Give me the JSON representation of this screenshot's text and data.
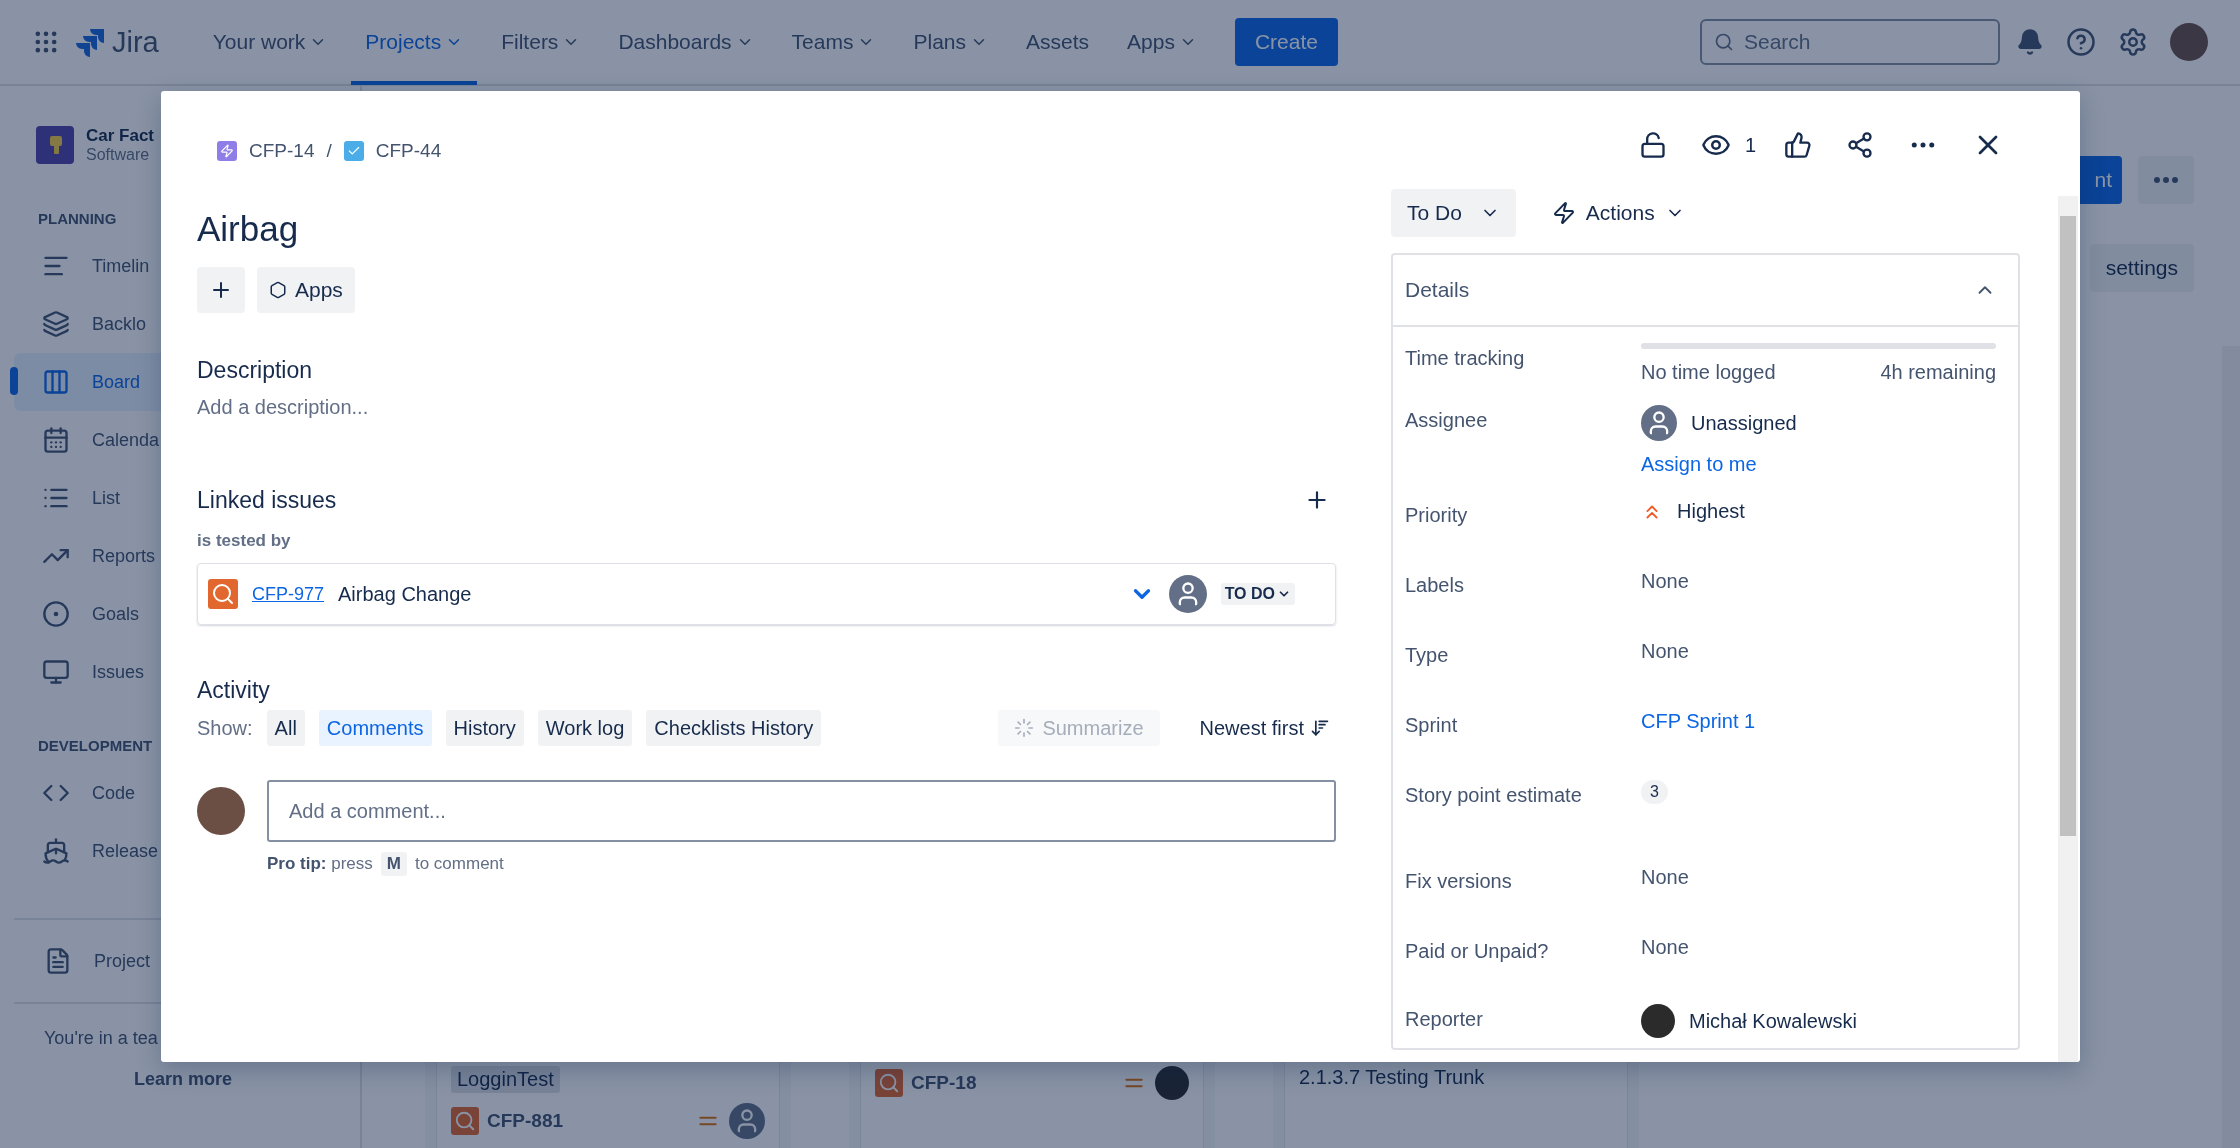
{
  "top_nav": {
    "app_name": "Jira",
    "menu": [
      {
        "label": "Your work",
        "selected": false
      },
      {
        "label": "Projects",
        "selected": true
      },
      {
        "label": "Filters",
        "selected": false
      },
      {
        "label": "Dashboards",
        "selected": false
      },
      {
        "label": "Teams",
        "selected": false
      },
      {
        "label": "Plans",
        "selected": false
      },
      {
        "label": "Assets",
        "selected": false,
        "caret": false
      },
      {
        "label": "Apps",
        "selected": false
      }
    ],
    "create_button": "Create",
    "search": {
      "placeholder": "Search"
    }
  },
  "sidebar": {
    "project_name": "Car Fact",
    "project_type": "Software",
    "sections": [
      {
        "heading": "PLANNING",
        "items": [
          {
            "label": "Timelin",
            "selected": false
          },
          {
            "label": "Backlo",
            "selected": false
          },
          {
            "label": "Board",
            "selected": true
          },
          {
            "label": "Calenda",
            "selected": false
          },
          {
            "label": "List",
            "selected": false
          },
          {
            "label": "Reports",
            "selected": false
          },
          {
            "label": "Goals",
            "selected": false
          },
          {
            "label": "Issues",
            "selected": false
          }
        ]
      },
      {
        "heading": "DEVELOPMENT",
        "items": [
          {
            "label": "Code",
            "selected": false
          },
          {
            "label": "Release",
            "selected": false
          }
        ]
      }
    ],
    "bottom_item": "Project",
    "footer_text": "You're in a tea",
    "footer_link": "Learn more"
  },
  "board": {
    "header_button": "nt",
    "settings_button": "settings",
    "columns": [
      {
        "cards": [
          {
            "label": "LogginTest",
            "key": "CFP-881",
            "assigned": false
          }
        ]
      },
      {
        "cards": [
          {
            "key": "CFP-18",
            "assigned": true
          }
        ]
      },
      {
        "cards": [
          {
            "title": "2.1.3.7 Testing Trunk"
          }
        ]
      }
    ]
  },
  "issue_modal": {
    "breadcrumbs": [
      {
        "key": "CFP-14",
        "kind": "epic"
      },
      {
        "key": "CFP-44",
        "kind": "task"
      }
    ],
    "separator": "/",
    "watchers": "1",
    "title": "Airbag",
    "apps_button": "Apps",
    "description": {
      "heading": "Description",
      "placeholder": "Add a description..."
    },
    "linked_issues": {
      "heading": "Linked issues",
      "relation": "is tested by",
      "items": [
        {
          "key": "CFP-977",
          "summary": "Airbag Change",
          "status": "TO DO"
        }
      ]
    },
    "activity": {
      "heading": "Activity",
      "show_label": "Show:",
      "filters": [
        {
          "label": "All",
          "selected": false
        },
        {
          "label": "Comments",
          "selected": true
        },
        {
          "label": "History",
          "selected": false
        },
        {
          "label": "Work log",
          "selected": false
        },
        {
          "label": "Checklists History",
          "selected": false
        }
      ],
      "summarize_button": {
        "label": "Summarize",
        "disabled": true
      },
      "sort_button": "Newest first",
      "comment": {
        "placeholder": "Add a comment..."
      },
      "pro_tip": "**Pro tip:** press",
      "pro_tip_key": "M",
      "pro_tip_after": "to comment"
    },
    "status_button": "To Do",
    "actions_button": "Actions",
    "details": {
      "heading": "Details",
      "expanded": true,
      "fields": [
        {
          "kind": "time",
          "label": "Time tracking",
          "logged": "No time logged",
          "remaining": "4h remaining",
          "level": 0
        },
        {
          "kind": "assignee",
          "label": "Assignee",
          "value": "Unassigned",
          "link": "Assign to me"
        },
        {
          "kind": "priority",
          "label": "Priority",
          "value": "Highest"
        },
        {
          "kind": "text",
          "label": "Labels",
          "value": "None"
        },
        {
          "kind": "text",
          "label": "Type",
          "value": "None"
        },
        {
          "kind": "link",
          "label": "Sprint",
          "value": "CFP Sprint 1"
        },
        {
          "kind": "badge",
          "label": "Story point estimate",
          "value": "3"
        },
        {
          "kind": "text",
          "label": "Fix versions",
          "value": "None"
        },
        {
          "kind": "text",
          "label": "Paid or Unpaid?",
          "value": "None"
        },
        {
          "kind": "user",
          "label": "Reporter",
          "value": "Michał Kowalewski"
        }
      ]
    }
  }
}
